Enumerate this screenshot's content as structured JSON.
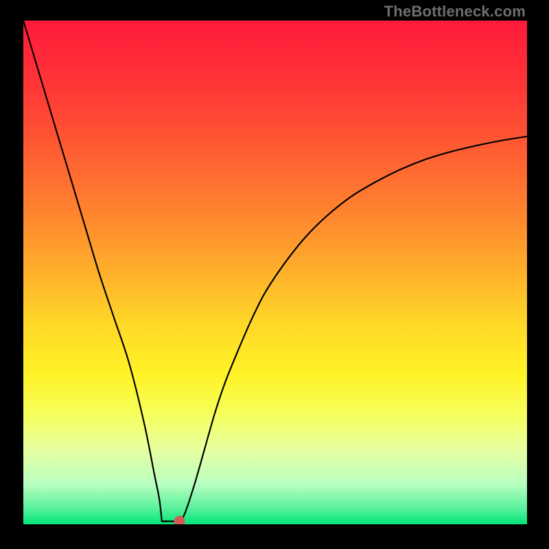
{
  "watermark": "TheBottleneck.com",
  "chart_data": {
    "type": "line",
    "title": "",
    "xlabel": "",
    "ylabel": "",
    "xlim": [
      0,
      100
    ],
    "ylim": [
      0,
      100
    ],
    "grid": false,
    "background_gradient": {
      "stops": [
        {
          "pos": 0.0,
          "color": "#ff1a3a"
        },
        {
          "pos": 0.1,
          "color": "#ff2f37"
        },
        {
          "pos": 0.2,
          "color": "#ff4a34"
        },
        {
          "pos": 0.3,
          "color": "#ff6a31"
        },
        {
          "pos": 0.4,
          "color": "#ff8a2e"
        },
        {
          "pos": 0.5,
          "color": "#ffb02b"
        },
        {
          "pos": 0.6,
          "color": "#ffd728"
        },
        {
          "pos": 0.7,
          "color": "#fff225"
        },
        {
          "pos": 0.78,
          "color": "#f6ff5a"
        },
        {
          "pos": 0.85,
          "color": "#e8ffa0"
        },
        {
          "pos": 0.92,
          "color": "#b8ffc0"
        },
        {
          "pos": 0.97,
          "color": "#55f09a"
        },
        {
          "pos": 1.0,
          "color": "#00e57a"
        }
      ]
    },
    "series": [
      {
        "name": "curve",
        "x": [
          0,
          3,
          6,
          9,
          12,
          15,
          18,
          21,
          24,
          26,
          27,
          28,
          29.5,
          31,
          32,
          34,
          36,
          38,
          40,
          42,
          45,
          48,
          52,
          56,
          60,
          65,
          70,
          75,
          80,
          85,
          90,
          95,
          100
        ],
        "y": [
          100,
          90,
          80,
          70,
          60,
          50,
          41,
          32,
          20,
          10,
          5,
          2,
          0.6,
          0.6,
          2,
          8,
          15,
          22,
          28,
          33,
          40,
          46,
          52,
          57,
          61,
          65,
          68,
          70.5,
          72.5,
          74,
          75.2,
          76.2,
          77
        ]
      }
    ],
    "flat_segment": {
      "x0": 27.5,
      "x1": 31,
      "y": 0.6
    },
    "minimum_point": {
      "x": 31,
      "y": 0.6,
      "color": "#d15a56",
      "radius_px": 8
    }
  }
}
